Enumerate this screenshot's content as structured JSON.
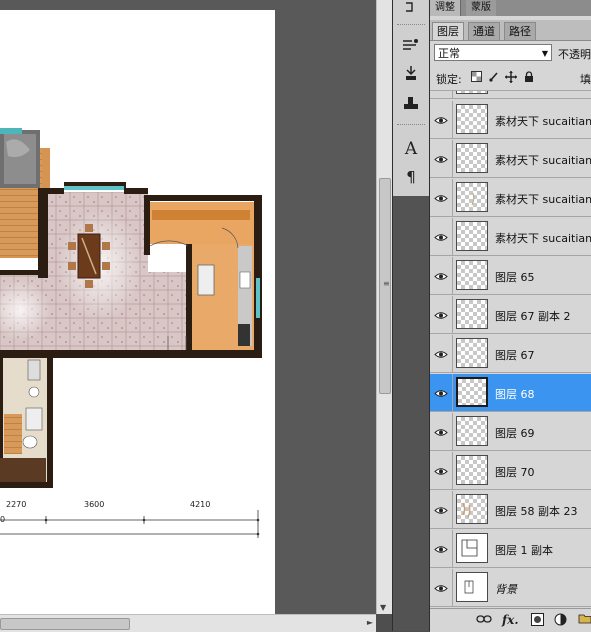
{
  "top_tabs": [
    "调整",
    "蒙版"
  ],
  "panel": {
    "tabs": [
      {
        "label": "图层",
        "active": true
      },
      {
        "label": "通道",
        "active": false
      },
      {
        "label": "路径",
        "active": false
      }
    ],
    "blend_mode": "正常",
    "opacity_label": "不透明",
    "lock_label": "锁定:",
    "fill_label": "填"
  },
  "layers": [
    {
      "name": "素材天下 sucaitianx",
      "visible": true,
      "selected": false
    },
    {
      "name": "素材天下 sucaitianx",
      "visible": true,
      "selected": false
    },
    {
      "name": "素材天下 sucaitianx",
      "visible": true,
      "selected": false
    },
    {
      "name": "素材天下 sucaitianx",
      "visible": true,
      "selected": false
    },
    {
      "name": "图层 65",
      "visible": true,
      "selected": false
    },
    {
      "name": "图层 67 副本 2",
      "visible": true,
      "selected": false
    },
    {
      "name": "图层 67",
      "visible": true,
      "selected": false
    },
    {
      "name": "图层 68",
      "visible": true,
      "selected": true
    },
    {
      "name": "图层 69",
      "visible": true,
      "selected": false
    },
    {
      "name": "图层 70",
      "visible": true,
      "selected": false
    },
    {
      "name": "图层 58 副本 23",
      "visible": true,
      "selected": false
    },
    {
      "name": "图层 1 副本",
      "visible": true,
      "selected": false
    },
    {
      "name": "背景",
      "visible": true,
      "selected": false
    }
  ],
  "dimensions": {
    "labels": [
      "2270",
      "3600",
      "4210"
    ],
    "partial": "0"
  },
  "panel_bottom_icons": [
    "link-icon",
    "fx-icon",
    "mask-icon",
    "adjustment-icon",
    "new-group-icon"
  ],
  "colors": {
    "selected_row": "#3b94f0",
    "panel_bg": "#d6d6d6",
    "canvas_bg": "#595959"
  }
}
